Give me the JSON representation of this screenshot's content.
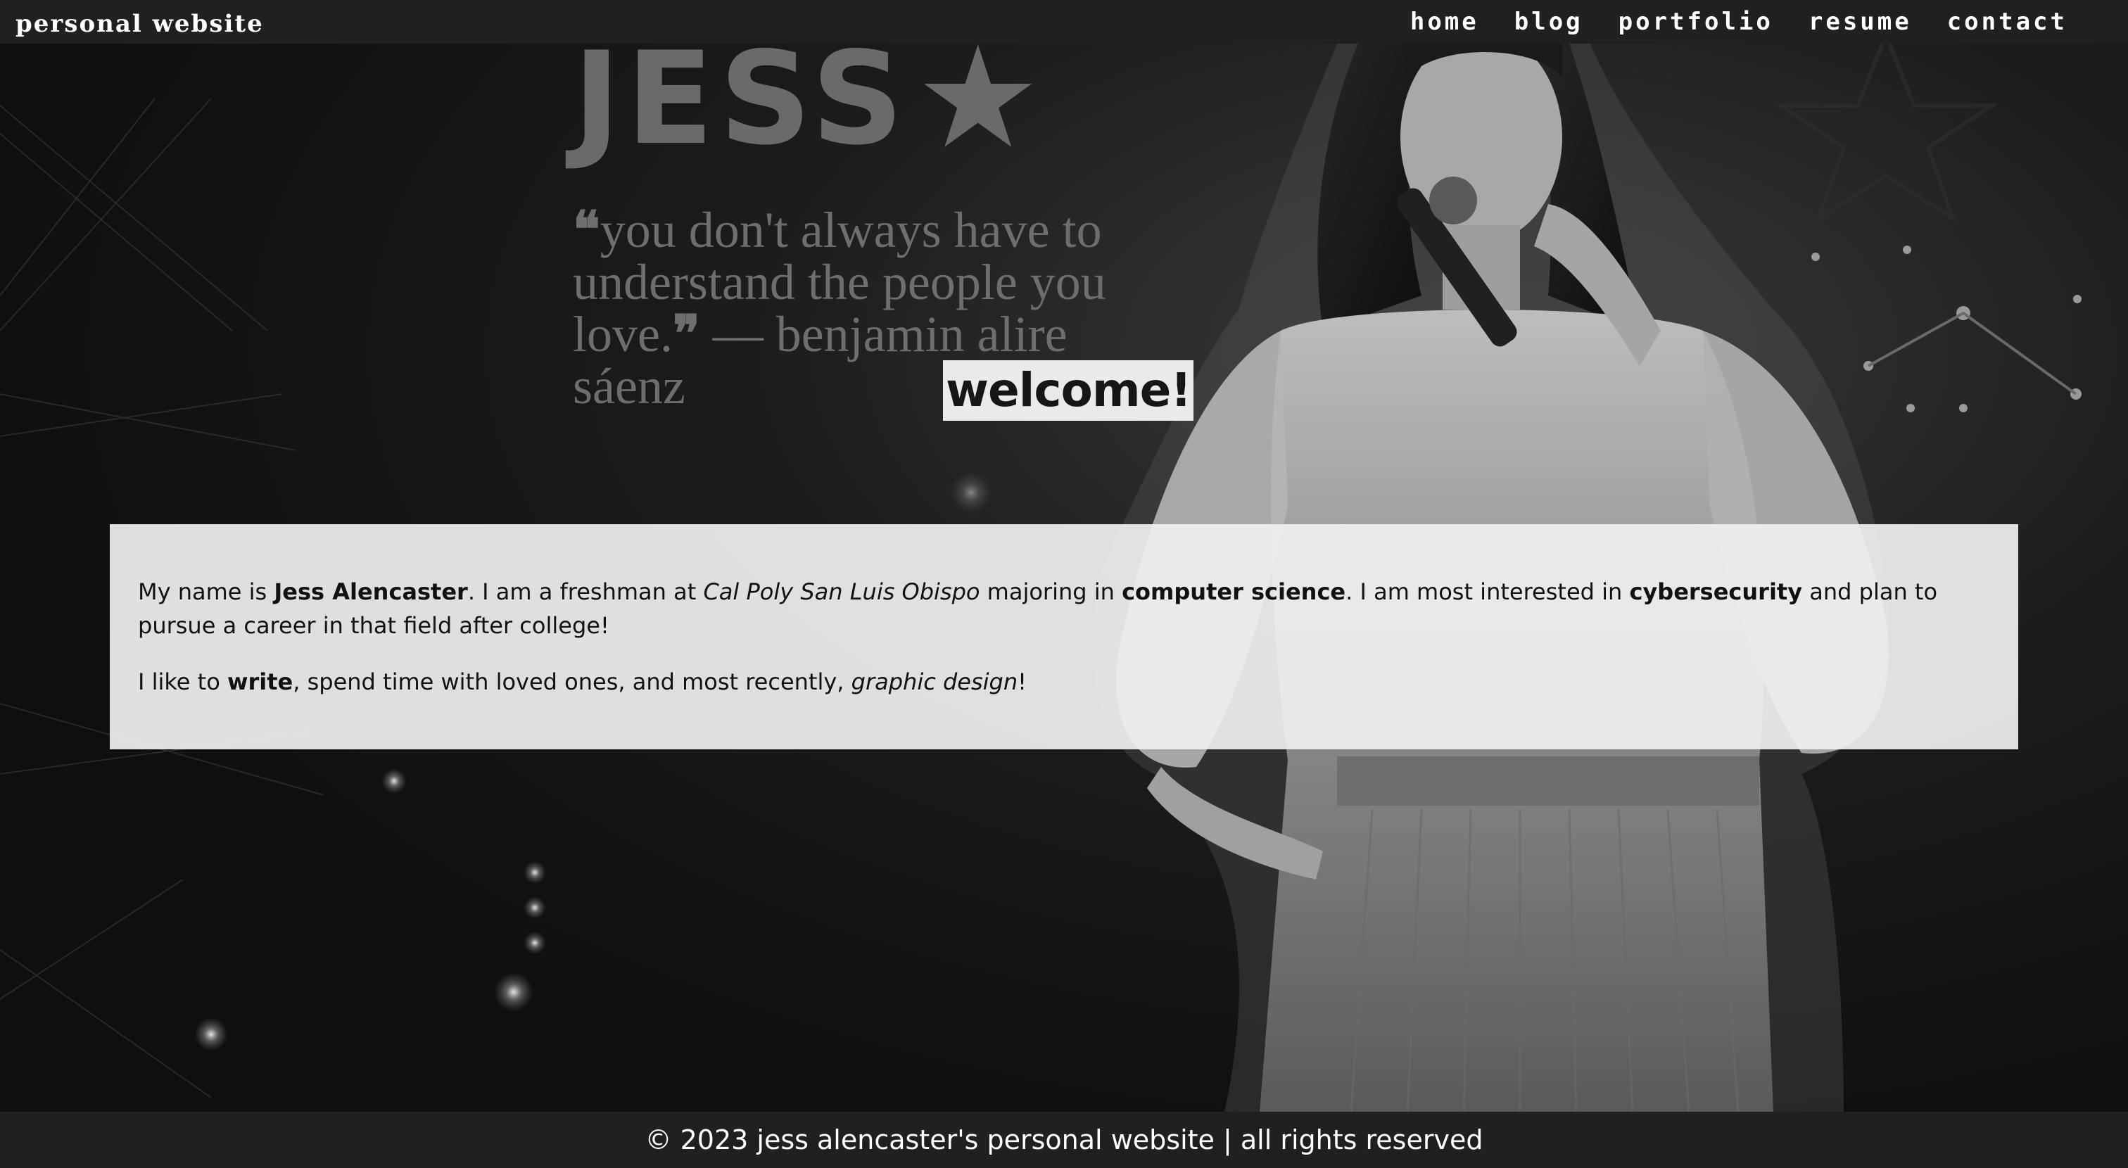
{
  "header": {
    "site_name": "personal website",
    "nav": [
      {
        "label": "home"
      },
      {
        "label": "blog"
      },
      {
        "label": "portfolio"
      },
      {
        "label": "resume"
      },
      {
        "label": "contact"
      }
    ]
  },
  "hero": {
    "title": "JESS",
    "star_glyph": "★",
    "quote_open": "❝",
    "quote_text": "you don't always have to understand the people you love.",
    "quote_close": "❞",
    "quote_attribution": " — benjamin alire sáenz",
    "welcome": "welcome!"
  },
  "about": {
    "p1": {
      "t1": "My name is ",
      "name": "Jess Alencaster",
      "t2": ". I am a freshman at ",
      "school": "Cal Poly San Luis Obispo",
      "t3": " majoring in ",
      "major": "computer science",
      "t4": ". I am most interested in ",
      "interest": "cybersecurity",
      "t5": " and plan to pursue a career in that field after college!"
    },
    "p2": {
      "t1": "I like to ",
      "hobby1": "write",
      "t2": ", spend time with loved ones, and most recently, ",
      "hobby2": "graphic design",
      "t3": "!"
    }
  },
  "footer": {
    "copyright": "© 2023 jess alencaster's personal website | all rights reserved"
  },
  "colors": {
    "bar_bg": "#202020",
    "page_bg": "#121212",
    "title_gray": "#6a6a6a",
    "about_bg": "#efefef",
    "welcome_bg": "#eaeaea"
  }
}
